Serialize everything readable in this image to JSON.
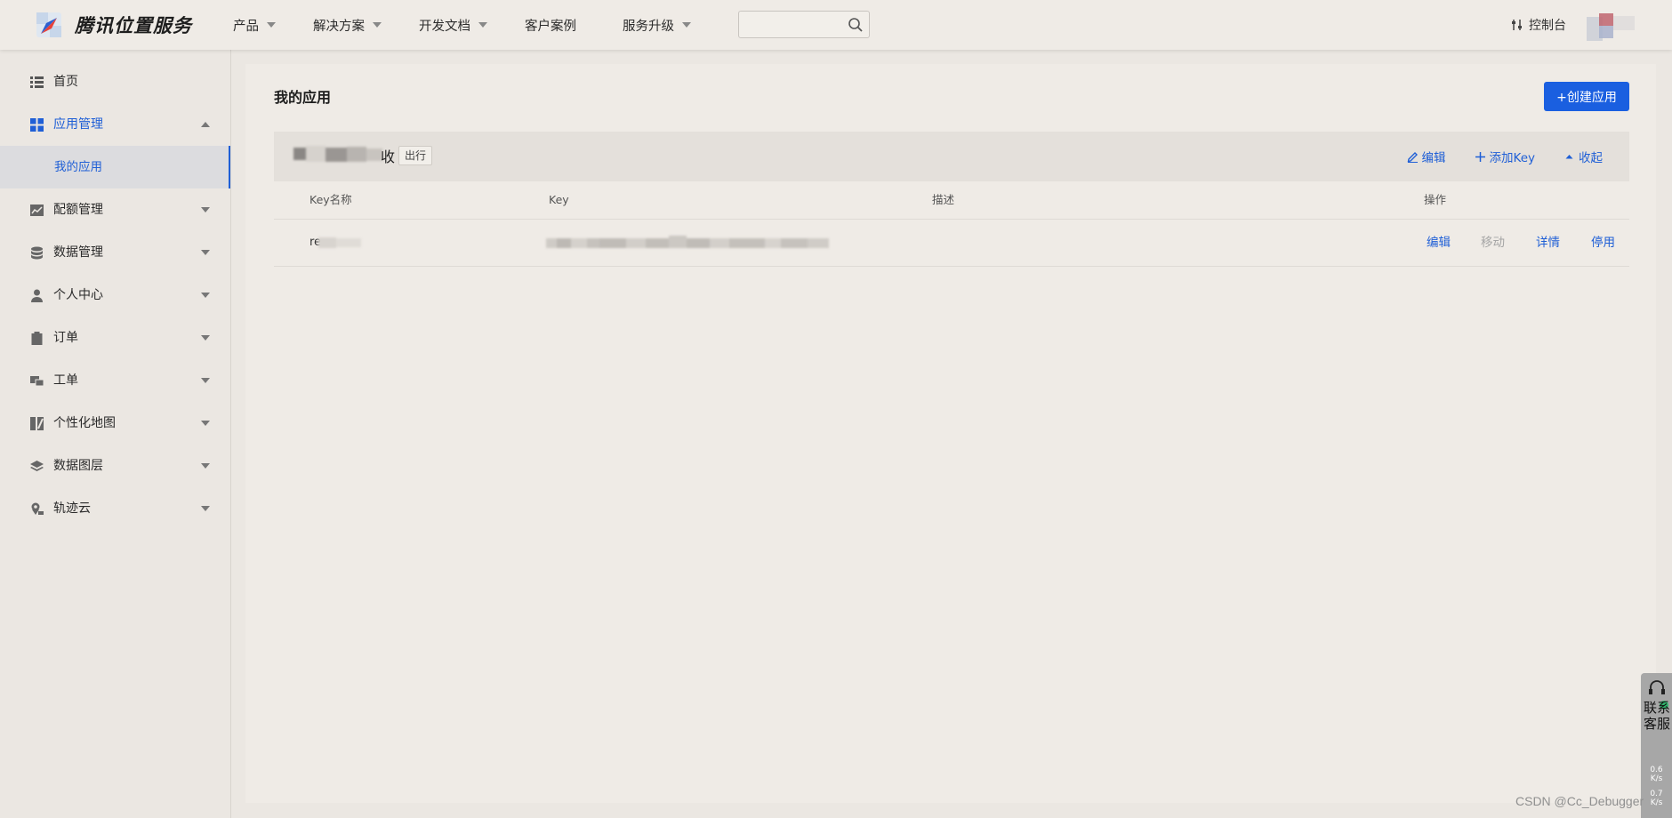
{
  "brand": {
    "name": "腾讯位置服务"
  },
  "nav": {
    "items": [
      {
        "label": "产品",
        "has_caret": true
      },
      {
        "label": "解决方案",
        "has_caret": true
      },
      {
        "label": "开发文档",
        "has_caret": true
      },
      {
        "label": "客户案例",
        "has_caret": false
      },
      {
        "label": "服务升级",
        "has_caret": true
      }
    ],
    "search": {
      "value": "",
      "placeholder": ""
    },
    "console_label": "控制台"
  },
  "sidebar": {
    "items": [
      {
        "label": "首页",
        "icon": "list-icon"
      },
      {
        "label": "应用管理",
        "icon": "grid-icon",
        "expanded": true
      },
      {
        "label": "我的应用",
        "sub": true,
        "selected": true
      },
      {
        "label": "配额管理",
        "icon": "chart-icon"
      },
      {
        "label": "数据管理",
        "icon": "database-icon"
      },
      {
        "label": "个人中心",
        "icon": "user-icon"
      },
      {
        "label": "订单",
        "icon": "clipboard-icon"
      },
      {
        "label": "工单",
        "icon": "ticket-icon"
      },
      {
        "label": "个性化地图",
        "icon": "map-style-icon"
      },
      {
        "label": "数据图层",
        "icon": "layers-icon"
      },
      {
        "label": "轨迹云",
        "icon": "location-icon"
      }
    ]
  },
  "main": {
    "title": "我的应用",
    "create_button": "+创建应用",
    "app": {
      "name_suffix": "收",
      "tag": "出行",
      "actions": {
        "edit": "编辑",
        "add_key": "添加Key",
        "collapse": "收起"
      }
    },
    "table": {
      "columns": [
        "Key名称",
        "Key",
        "描述",
        "操作"
      ],
      "rows": [
        {
          "key_name": "re",
          "key": "",
          "description": "",
          "actions": [
            "编辑",
            "移动",
            "详情",
            "停用"
          ]
        }
      ]
    }
  },
  "service_widget": {
    "label": "联系客服",
    "stat_1": "0.6",
    "stat_1_unit": "K/s",
    "stat_2": "0.7",
    "stat_2_unit": "K/s"
  },
  "watermark": "CSDN @Cc_Debugger",
  "colors": {
    "accent": "#1f5fd6",
    "button": "#1a5fe0",
    "background": "#ebe7e2"
  }
}
